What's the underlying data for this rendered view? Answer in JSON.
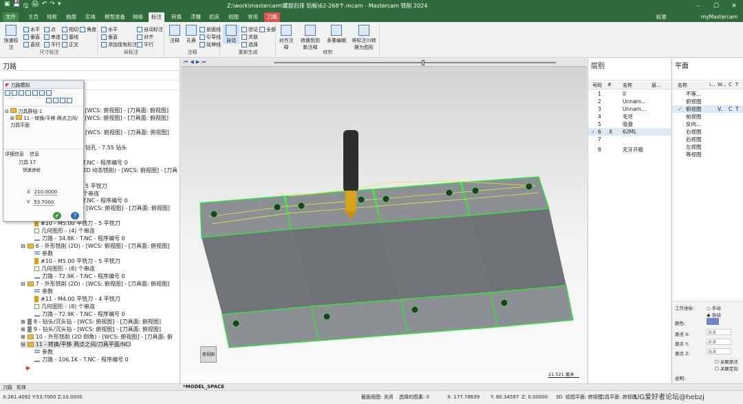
{
  "title_bar": {
    "title": "Z:\\work\\mastercam\\螺旋石排 铝板\\62-268个.mcam - Mastercam 铣削 2024",
    "quick_access": [
      "▣",
      "💾",
      "🖫",
      "🖨",
      "↶",
      "↷",
      "▾"
    ]
  },
  "ribbon_tabs": [
    "文件",
    "主页",
    "线框",
    "曲面",
    "实体",
    "模型准备",
    "网格",
    "标注",
    "转换",
    "浮雕",
    "机床",
    "视图",
    "常用",
    "刀路"
  ],
  "active_tab": "标注",
  "tab_right": [
    "标准",
    "myMastercam"
  ],
  "ribbon": {
    "groups": [
      {
        "label": "尺寸标注",
        "buttons": [
          "快速标注",
          "水平",
          "垂直",
          "相切",
          "基线",
          "角度",
          "平行",
          "点",
          "直径",
          "串连",
          "正交"
        ]
      },
      {
        "label": "纵标注",
        "buttons": [
          "水平",
          "垂直",
          "添加现有标注",
          "自动标注",
          "对齐",
          "平行"
        ]
      },
      {
        "label": "注释",
        "buttons": [
          "注释",
          "孔表",
          "剖面线",
          "引导线",
          "延伸线"
        ]
      },
      {
        "label": "重新生成",
        "buttons": [
          "自动",
          "验证",
          "全部",
          "关联",
          "选择"
        ]
      },
      {
        "label": "修剪",
        "buttons": [
          "对齐注释",
          "转换到到新注释",
          "多重编辑",
          "将标注(I)转换为图形"
        ]
      }
    ]
  },
  "left_panel": {
    "title": "刀路",
    "tree_rows": [
      "- [WCS: 俯视图] - [刀具面: 俯视图]",
      "- [WCS: 俯视图] - [刀具面: 俯视图]",
      "[WCS: 俯视图] - [刀具面: 俯视图]",
      "钻孔 - 7.55 钻头",
      "T.NC - 程序编号 0",
      "2D 动态铣削) - [WCS: 俯视图] - [刀具",
      "5 平铣刀",
      "个串连",
      "T.NC - 程序编号 0",
      "- [WCS: 俯视图] - [刀具面: 俯视图]",
      "#10 - M5.00 平铣刀 - 5 平铣刀",
      "几何图形 - (4) 个串连",
      "刀路 - 34.8K - T.NC - 程序编号 0",
      "6 - 外形铣削 (2D) - [WCS: 俯视图] - [刀具面: 俯视图]",
      "参数",
      "#10 - M5.00 平铣刀 - 5 平铣刀",
      "几何图形 - (8) 个串连",
      "刀路 - 72.9K - T.NC - 程序编号 0",
      "7 - 外形铣削 (2D) - [WCS: 俯视图] - [刀具面: 俯视图]",
      "参数",
      "#11 - M4.00 平铣刀 - 4 平铣刀",
      "几何图形 - (8) 个串连",
      "刀路 - 72.9K - T.NC - 程序编号 0",
      "8 - 钻头/沉头钻 - [WCS: 俯视图] - [刀具面: 俯视图]",
      "9 - 钻头/沉头钻 - [WCS: 俯视图] - [刀具面: 俯视图]",
      "10 - 外形铣削 (2D 倒角) - [WCS: 俯视图] - [刀具面: 俯",
      "11 - 转换/平移 两点之间/刀具平面/NCI",
      "参数",
      "刀路 - 106.1K - T.NC - 程序编号 0"
    ]
  },
  "dialog": {
    "title": "刀路模拟",
    "tree_root": "刀具群组-1",
    "tree_child": "11 - 转换/平移 两点之间/刀具平面",
    "info_tab": "详细信息",
    "info_tab2": "信息",
    "tool_label": "刀具 17",
    "mode_label": "快速进给",
    "x_label": "X",
    "x_value": "210.0000",
    "y_label": "Y",
    "y_value": "53.7000"
  },
  "viewport": {
    "model_space": "*MODEL_SPACE",
    "scale_bar": "21.521 毫米",
    "view_label": "俯视图"
  },
  "levels_panel": {
    "title": "层别",
    "headers": [
      "号码",
      "#",
      "名称",
      "层..."
    ],
    "rows": [
      {
        "num": "1",
        "mark": "",
        "name": "0"
      },
      {
        "num": "2",
        "mark": "",
        "name": "Unnam..."
      },
      {
        "num": "3",
        "mark": "",
        "name": "Unnam..."
      },
      {
        "num": "4",
        "mark": "",
        "name": "毛坯"
      },
      {
        "num": "5",
        "mark": "",
        "name": "吸盘"
      },
      {
        "num": "6",
        "mark": "X",
        "name": "62ML"
      },
      {
        "num": "7",
        "mark": "",
        "name": ""
      },
      {
        "num": "8",
        "mark": "",
        "name": "无牙开粗"
      }
    ]
  },
  "planes_panel": {
    "title": "平面",
    "headers": [
      "名称",
      "i...",
      "W...",
      "C",
      "T"
    ],
    "rows": [
      "不等...",
      "俯视图",
      "俯视图",
      "前视图",
      "反向...",
      "右视图",
      "后视图",
      "左视图",
      "等视图"
    ],
    "fields": {
      "work_coord_label": "工作坐标:",
      "manual": "手动",
      "auto": "自动",
      "color_label": "颜色:",
      "origin_x_label": "原点 X:",
      "origin_y_label": "原点 Y:",
      "origin_z_label": "原点 Z:",
      "origin_x": "0.0",
      "origin_y": "0.0",
      "origin_z": "0.0",
      "checkbox1": "关联原点",
      "checkbox2": "关联定向",
      "note_label": "说明:"
    }
  },
  "bottom_tabs": [
    "刀路",
    "实体"
  ],
  "status_bar": {
    "coords": "X:261.4092  Y:53.7000  Z:10.0000",
    "section_view": "截面视图: 关闭",
    "selected": "选择的图素: 0",
    "x": "X:   177.78639",
    "y": "Y:   80.34597",
    "z": "Z:  0.00000",
    "mode": "3D",
    "plane1": "绘图平面: 俯视图",
    "plane2": "刀具平面: 俯视图",
    "wcs": "WCS: 俯视图"
  },
  "watermark": "UG爱好者论坛@hebzj"
}
